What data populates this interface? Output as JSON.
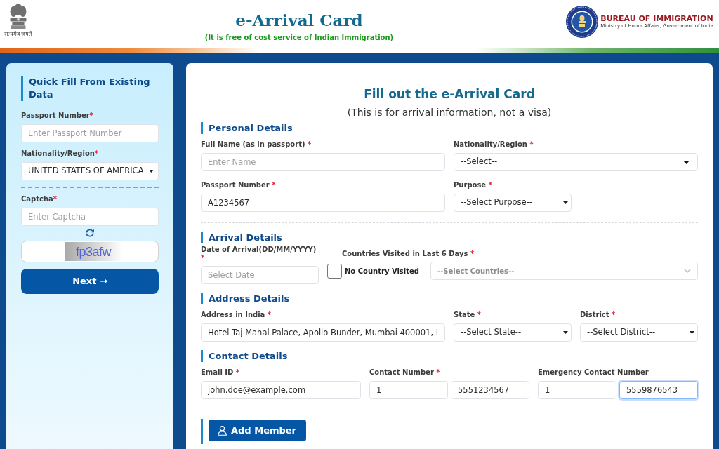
{
  "header": {
    "emblem_caption": "सत्यमेव जयते",
    "title": "e-Arrival Card",
    "subtitle": "(It is free of cost service of Indian Immigration)",
    "agency_name": "BUREAU OF IMMIGRATION",
    "agency_ministry": "Ministry of Home Affairs, Government of India"
  },
  "quick_fill": {
    "title": "Quick Fill From Existing Data",
    "fields": [
      {
        "kind": "text",
        "label": "Passport Number",
        "required_mark": "*",
        "placeholder": "Enter Passport Number"
      },
      {
        "kind": "select",
        "label": "Nationality/Region",
        "required_mark": "*",
        "value": "UNITED STATES OF AMERICA"
      },
      {
        "kind": "captcha",
        "label": "Captcha",
        "required_mark": "*",
        "placeholder": "Enter Captcha",
        "captcha_text": "fp3afw"
      }
    ],
    "next_button": "Next →"
  },
  "form": {
    "title": "Fill out the e-Arrival Card",
    "subtitle": "(This is for arrival information, not a visa)",
    "blocks": [
      {
        "kind": "section",
        "title": "Personal Details",
        "rows": [
          {
            "kind": "halves",
            "fields": [
              {
                "kind": "text",
                "label": "Full Name (as in passport)",
                "required_mark": "*",
                "placeholder": "Enter Name"
              },
              {
                "kind": "search-select",
                "label": "Nationality/Region",
                "required_mark": "*",
                "value": "--Select--"
              }
            ]
          },
          {
            "kind": "halves",
            "fields": [
              {
                "kind": "text",
                "label": "Passport Number",
                "required_mark": "*",
                "value": "A1234567"
              },
              {
                "kind": "select",
                "label": "Purpose",
                "required_mark": "*",
                "value": "--Select Purpose--"
              }
            ]
          }
        ]
      },
      {
        "kind": "divider"
      },
      {
        "kind": "section",
        "title": "Arrival Details",
        "rows": [
          {
            "kind": "date-countries",
            "fields": [
              {
                "kind": "date",
                "label": "Date of Arrival(DD/MM/YYYY)",
                "required_mark": "*",
                "placeholder": "Select Date"
              },
              {
                "kind": "countries",
                "label": "Countries Visited in Last 6 Days",
                "required_mark": "*",
                "checkbox": {
                  "label": "No Country Visited",
                  "checked": false
                },
                "placeholder": "--Select Countries--"
              }
            ]
          }
        ]
      },
      {
        "kind": "section",
        "title": "Address Details",
        "rows": [
          {
            "kind": "wide-narrow-narrow",
            "fields": [
              {
                "kind": "text",
                "label": "Address in India",
                "required_mark": "*",
                "value": "Hotel Taj Mahal Palace, Apollo Bunder, Mumbai 400001, I"
              },
              {
                "kind": "select",
                "label": "State",
                "required_mark": "*",
                "value": "--Select State--"
              },
              {
                "kind": "select",
                "label": "District",
                "required_mark": "*",
                "value": "--Select District--"
              }
            ]
          }
        ]
      },
      {
        "kind": "section",
        "title": "Contact Details",
        "rows": [
          {
            "kind": "thirds",
            "fields": [
              {
                "kind": "text",
                "label": "Email ID",
                "required_mark": "*",
                "value": "john.doe@example.com"
              },
              {
                "kind": "phone",
                "label": "Contact Number",
                "required_mark": "*",
                "code": "1",
                "number": "5551234567",
                "focused": false
              },
              {
                "kind": "phone",
                "label": "Emergency Contact Number",
                "code": "1",
                "number": "5559876543",
                "focused": true
              }
            ]
          }
        ]
      },
      {
        "kind": "divider"
      }
    ],
    "add_member_button": "Add Member"
  }
}
